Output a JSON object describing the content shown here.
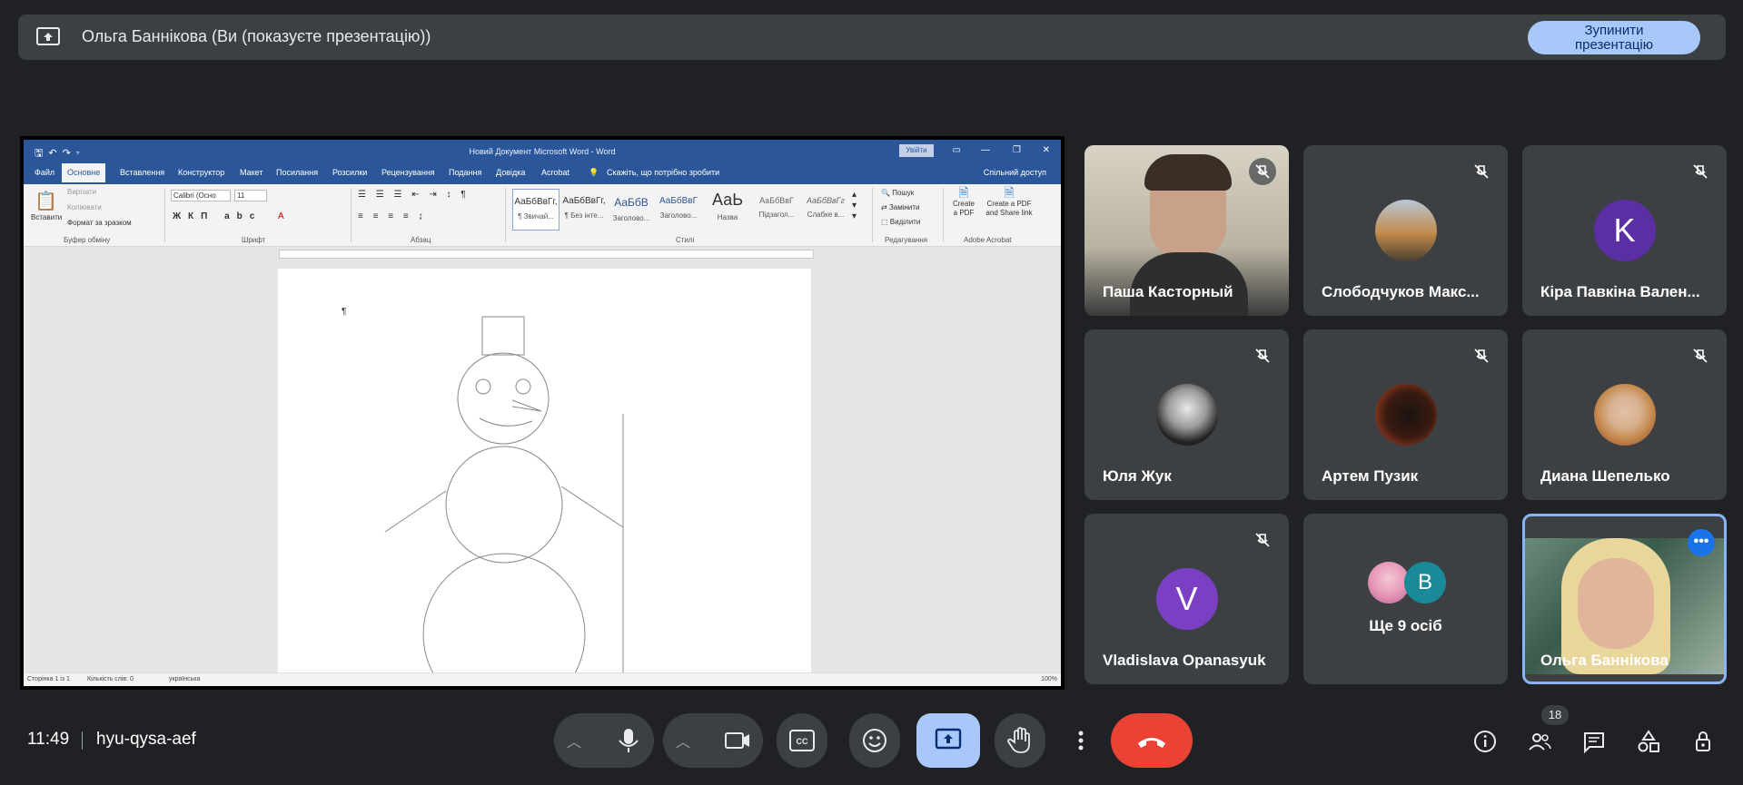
{
  "banner": {
    "presenter_text": "Ольга Баннікова (Ви (показуєте презентацію))",
    "stop_button_label": "Зупинити\nпрезентацію"
  },
  "word": {
    "window_title": "Новий Документ Microsoft Word  -  Word",
    "login_label": "Увійти",
    "tabs": [
      "Файл",
      "Основне",
      "Вставлення",
      "Конструктор",
      "Макет",
      "Посилання",
      "Розсилки",
      "Рецензування",
      "Подання",
      "Довідка",
      "Acrobat"
    ],
    "tell_me": "Скажіть, що потрібно зробити",
    "share": "Спільний доступ",
    "ribbon": {
      "paste": "Вставити",
      "cut": "Вирізати",
      "copy": "Копіювати",
      "format_painter": "Формат за зразком",
      "clipboard_group": "Буфер обміну",
      "font_name": "Calibri (Осно",
      "font_size": "11",
      "font_group": "Шрифт",
      "paragraph_group": "Абзац",
      "styles_group": "Стилі",
      "editing_group": "Редагування",
      "acrobat_group": "Adobe Acrobat",
      "find": "Пошук",
      "replace": "Замінити",
      "select": "Виділити",
      "create_pdf": "Create a PDF",
      "create_share": "Create a PDF and Share link",
      "styles": [
        {
          "preview": "АаБбВвГг,",
          "name": "¶ Звичай..."
        },
        {
          "preview": "АаБбВвГг,",
          "name": "¶ Без інте..."
        },
        {
          "preview": "АаБбВ",
          "name": "Заголово..."
        },
        {
          "preview": "АаБбВвГ",
          "name": "Заголово..."
        },
        {
          "preview": "АаЬ",
          "name": "Назва"
        },
        {
          "preview": "АаБбВвГ",
          "name": "Підзагол..."
        },
        {
          "preview": "АаБбВвГг",
          "name": "Слабке в..."
        }
      ]
    },
    "pilcrow": "¶",
    "status": {
      "page": "Сторінка 1 із 1",
      "words": "Кількість слів: 0",
      "lang": "українська",
      "zoom": "100%"
    }
  },
  "participants": [
    {
      "name": "Паша Касторный",
      "type": "video"
    },
    {
      "name": "Слободчуков Макс...",
      "type": "photo"
    },
    {
      "name": "Кіра Павкіна Вален...",
      "type": "letter",
      "letter": "K",
      "color": "#5b2fa3"
    },
    {
      "name": "Юля Жук",
      "type": "photo"
    },
    {
      "name": "Артем Пузик",
      "type": "photo"
    },
    {
      "name": "Диана Шепелько",
      "type": "photo"
    },
    {
      "name": "Vladislava Opanasyuk",
      "type": "letter",
      "letter": "V",
      "color": "#7b3fc4"
    },
    {
      "name": "Ще 9 осіб",
      "type": "group",
      "letter": "B",
      "color": "#1a8a9a"
    },
    {
      "name": "Ольга Баннікова",
      "type": "video-self"
    }
  ],
  "bottom": {
    "time": "11:49",
    "meeting_code": "hyu-qysa-aef",
    "people_count": "18"
  },
  "colors": {
    "background": "#202124",
    "tile": "#3c4043",
    "accent": "#a8c7fa",
    "end_call": "#ea4335",
    "word_blue": "#2b579a"
  }
}
